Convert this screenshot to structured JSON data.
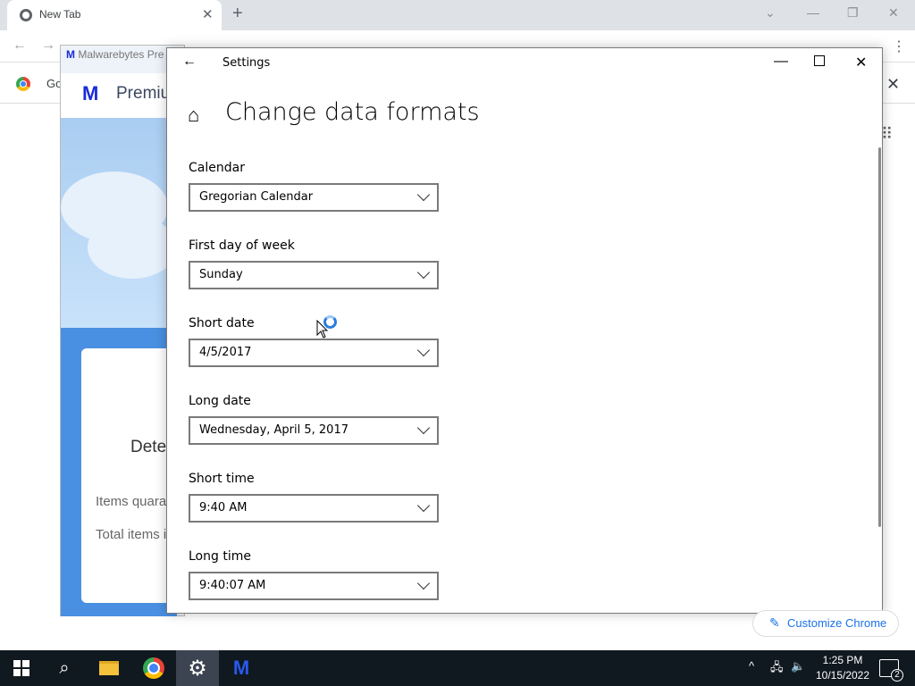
{
  "browser": {
    "tab_title": "New Tab",
    "tab_close": "✕",
    "new_tab": "+",
    "bookmark_label": "Go",
    "customize_label": "Customize Chrome"
  },
  "malwarebytes": {
    "title": "Malwarebytes Pre",
    "brand": "Premiu",
    "card_heading": "Dete",
    "items_label": "Items quara",
    "total_label": "Total items i"
  },
  "settings": {
    "window_title": "Settings",
    "page_heading": "Change data formats",
    "fields": [
      {
        "label": "Calendar",
        "value": "Gregorian Calendar"
      },
      {
        "label": "First day of week",
        "value": "Sunday"
      },
      {
        "label": "Short date",
        "value": "4/5/2017"
      },
      {
        "label": "Long date",
        "value": "Wednesday, April 5, 2017"
      },
      {
        "label": "Short time",
        "value": "9:40 AM"
      },
      {
        "label": "Long time",
        "value": "9:40:07 AM"
      }
    ]
  },
  "taskbar": {
    "time": "1:25 PM",
    "date": "10/15/2022",
    "notification_count": "2",
    "accent": "#2a7de1"
  }
}
